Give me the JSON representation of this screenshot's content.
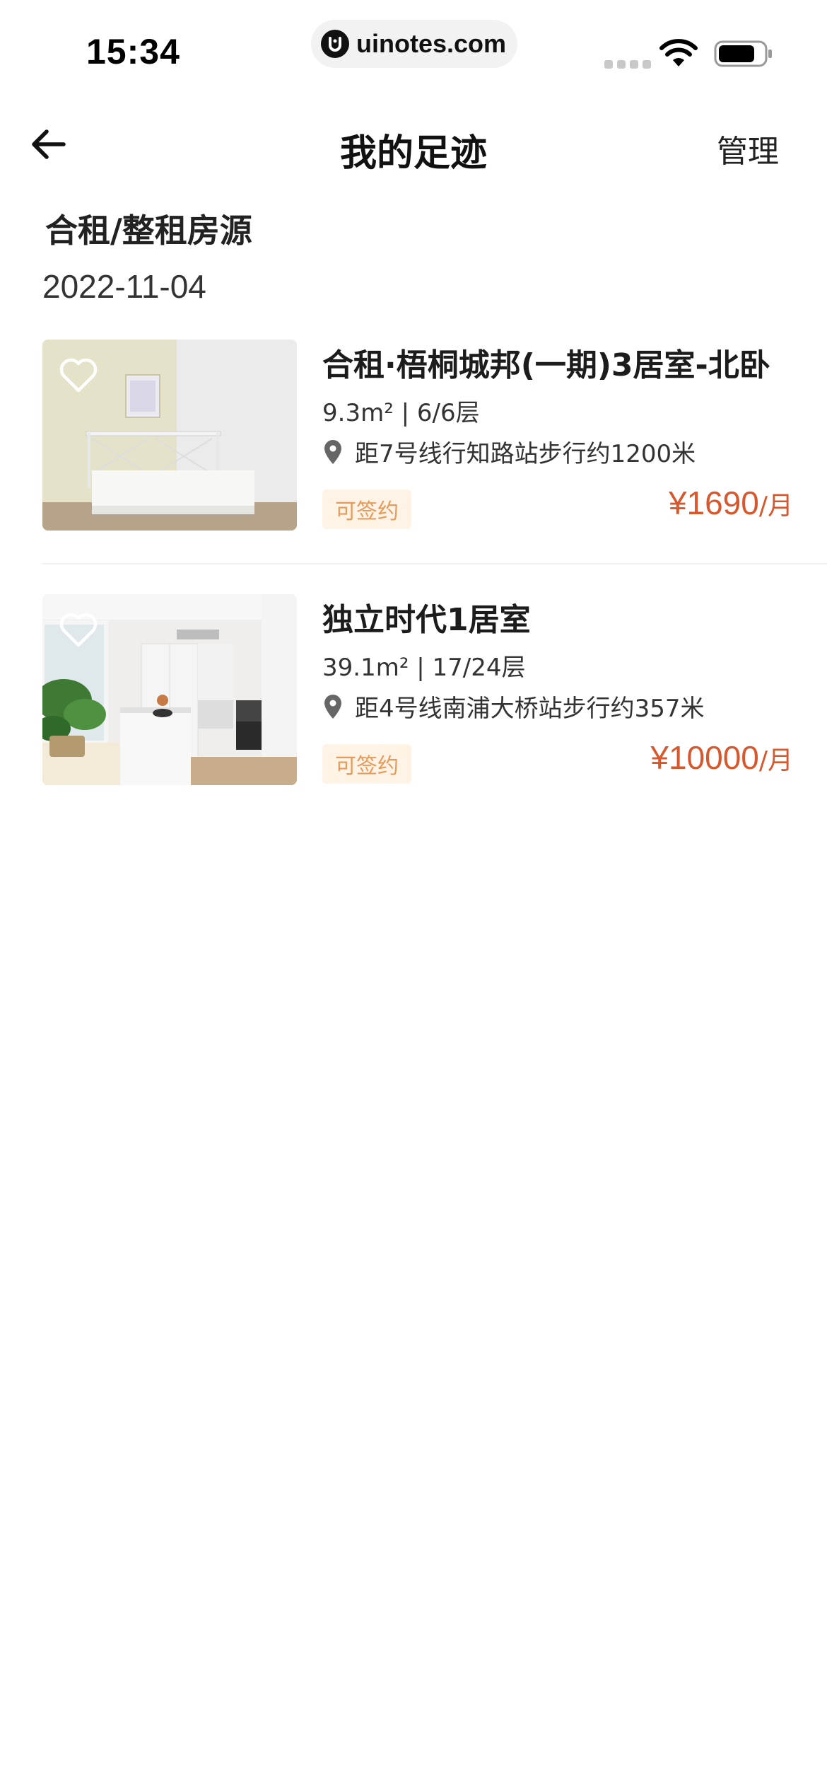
{
  "status_bar": {
    "time": "15:34",
    "url": "uinotes.com",
    "icons": [
      "signal-icon",
      "wifi-icon",
      "battery-icon"
    ]
  },
  "nav": {
    "title": "我的足迹",
    "manage_label": "管理",
    "back_icon": "back-arrow-icon"
  },
  "section": {
    "title": "合租/整租房源",
    "date": "2022-11-04"
  },
  "listings": [
    {
      "title": "合租·梧桐城邦(一期)3居室-北卧",
      "specs": "9.3m² | 6/6层",
      "distance": "距7号线行知路站步行约1200米",
      "tag": "可签约",
      "price": "¥1690",
      "price_unit": "/月"
    },
    {
      "title": "独立时代1居室",
      "specs": "39.1m² | 17/24层",
      "distance": "距4号线南浦大桥站步行约357米",
      "tag": "可签约",
      "price": "¥10000",
      "price_unit": "/月"
    }
  ],
  "colors": {
    "price": "#d8572c",
    "tag_text": "#e69a5a",
    "tag_bg": "#fff3e6"
  }
}
